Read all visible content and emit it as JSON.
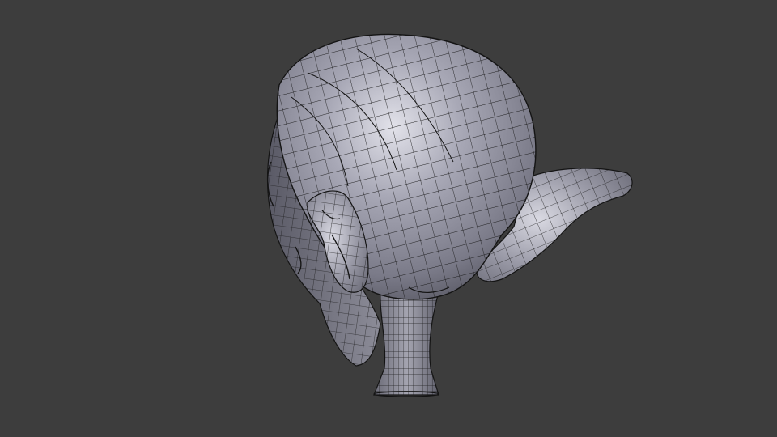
{
  "viewport": {
    "background_color": "#3d3d3d",
    "shading": "solid",
    "overlay": "wireframe"
  },
  "scene": {
    "object_icon": "sculpted-head-mesh-icon",
    "mesh_color": "#9a9aa6",
    "wire_color": "#1a1a1a"
  }
}
